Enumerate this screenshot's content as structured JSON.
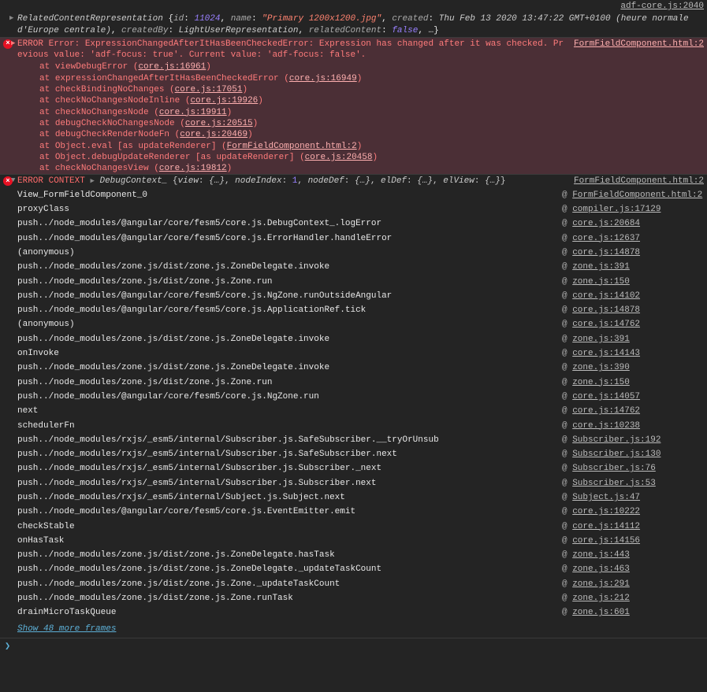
{
  "topLink": {
    "text": "adf-core.js:2040"
  },
  "objPreview": {
    "className": "RelatedContentRepresentation",
    "idKey": "id",
    "idVal": "11024",
    "nameKey": "name",
    "nameVal": "\"Primary 1200x1200.jpg\"",
    "createdKey": "created",
    "createdVal": "Thu Feb 13 2020 13:47:22 GMT+0100 (heure normale d'Europe centrale)",
    "createdByKey": "createdBy",
    "createdByVal": "LightUserRepresentation",
    "relatedKey": "relatedContent",
    "relatedVal": "false",
    "trail": ", …}"
  },
  "error": {
    "prefix": "ERROR",
    "msg": "Error: ExpressionChangedAfterItHasBeenCheckedError: Expression has changed after it was checked. Previous value: 'adf-focus: true'. Current value: 'adf-focus: false'.",
    "src": "FormFieldComponent.html:2",
    "stack": [
      {
        "fn": "viewDebugError",
        "loc": "core.js:16961"
      },
      {
        "fn": "expressionChangedAfterItHasBeenCheckedError",
        "loc": "core.js:16949"
      },
      {
        "fn": "checkBindingNoChanges",
        "loc": "core.js:17051"
      },
      {
        "fn": "checkNoChangesNodeInline",
        "loc": "core.js:19926"
      },
      {
        "fn": "checkNoChangesNode",
        "loc": "core.js:19911"
      },
      {
        "fn": "debugCheckNoChangesNode",
        "loc": "core.js:20515"
      },
      {
        "fn": "debugCheckRenderNodeFn",
        "loc": "core.js:20469"
      },
      {
        "fn": "Object.eval [as updateRenderer]",
        "loc": "FormFieldComponent.html:2"
      },
      {
        "fn": "Object.debugUpdateRenderer [as updateRenderer]",
        "loc": "core.js:20458"
      },
      {
        "fn": "checkNoChangesView",
        "loc": "core.js:19812"
      }
    ]
  },
  "context": {
    "label": "ERROR CONTEXT",
    "objName": "DebugContext_",
    "parts": {
      "viewK": "view",
      "viewV": "{…}",
      "nodeIndexK": "nodeIndex",
      "nodeIndexV": "1",
      "nodeDefK": "nodeDef",
      "nodeDefV": "{…}",
      "elDefK": "elDef",
      "elDefV": "{…}",
      "elViewK": "elView",
      "elViewV": "{…}"
    },
    "src": "FormFieldComponent.html:2"
  },
  "traceHead": "View_FormFieldComponent_0",
  "traceHeadSrc": "FormFieldComponent.html:2",
  "trace": [
    {
      "fn": "proxyClass",
      "src": "compiler.js:17129"
    },
    {
      "fn": "push../node_modules/@angular/core/fesm5/core.js.DebugContext_.logError",
      "src": "core.js:20684"
    },
    {
      "fn": "push../node_modules/@angular/core/fesm5/core.js.ErrorHandler.handleError",
      "src": "core.js:12637"
    },
    {
      "fn": "(anonymous)",
      "src": "core.js:14878"
    },
    {
      "fn": "push../node_modules/zone.js/dist/zone.js.ZoneDelegate.invoke",
      "src": "zone.js:391"
    },
    {
      "fn": "push../node_modules/zone.js/dist/zone.js.Zone.run",
      "src": "zone.js:150"
    },
    {
      "fn": "push../node_modules/@angular/core/fesm5/core.js.NgZone.runOutsideAngular",
      "src": "core.js:14102"
    },
    {
      "fn": "push../node_modules/@angular/core/fesm5/core.js.ApplicationRef.tick",
      "src": "core.js:14878"
    },
    {
      "fn": "(anonymous)",
      "src": "core.js:14762"
    },
    {
      "fn": "push../node_modules/zone.js/dist/zone.js.ZoneDelegate.invoke",
      "src": "zone.js:391"
    },
    {
      "fn": "onInvoke",
      "src": "core.js:14143"
    },
    {
      "fn": "push../node_modules/zone.js/dist/zone.js.ZoneDelegate.invoke",
      "src": "zone.js:390"
    },
    {
      "fn": "push../node_modules/zone.js/dist/zone.js.Zone.run",
      "src": "zone.js:150"
    },
    {
      "fn": "push../node_modules/@angular/core/fesm5/core.js.NgZone.run",
      "src": "core.js:14057"
    },
    {
      "fn": "next",
      "src": "core.js:14762"
    },
    {
      "fn": "schedulerFn",
      "src": "core.js:10238"
    },
    {
      "fn": "push../node_modules/rxjs/_esm5/internal/Subscriber.js.SafeSubscriber.__tryOrUnsub",
      "src": "Subscriber.js:192"
    },
    {
      "fn": "push../node_modules/rxjs/_esm5/internal/Subscriber.js.SafeSubscriber.next",
      "src": "Subscriber.js:130"
    },
    {
      "fn": "push../node_modules/rxjs/_esm5/internal/Subscriber.js.Subscriber._next",
      "src": "Subscriber.js:76"
    },
    {
      "fn": "push../node_modules/rxjs/_esm5/internal/Subscriber.js.Subscriber.next",
      "src": "Subscriber.js:53"
    },
    {
      "fn": "push../node_modules/rxjs/_esm5/internal/Subject.js.Subject.next",
      "src": "Subject.js:47"
    },
    {
      "fn": "push../node_modules/@angular/core/fesm5/core.js.EventEmitter.emit",
      "src": "core.js:10222"
    },
    {
      "fn": "checkStable",
      "src": "core.js:14112"
    },
    {
      "fn": "onHasTask",
      "src": "core.js:14156"
    },
    {
      "fn": "push../node_modules/zone.js/dist/zone.js.ZoneDelegate.hasTask",
      "src": "zone.js:443"
    },
    {
      "fn": "push../node_modules/zone.js/dist/zone.js.ZoneDelegate._updateTaskCount",
      "src": "zone.js:463"
    },
    {
      "fn": "push../node_modules/zone.js/dist/zone.js.Zone._updateTaskCount",
      "src": "zone.js:291"
    },
    {
      "fn": "push../node_modules/zone.js/dist/zone.js.Zone.runTask",
      "src": "zone.js:212"
    },
    {
      "fn": "drainMicroTaskQueue",
      "src": "zone.js:601"
    }
  ],
  "showMore": "Show 48 more frames",
  "prompt": "❯"
}
